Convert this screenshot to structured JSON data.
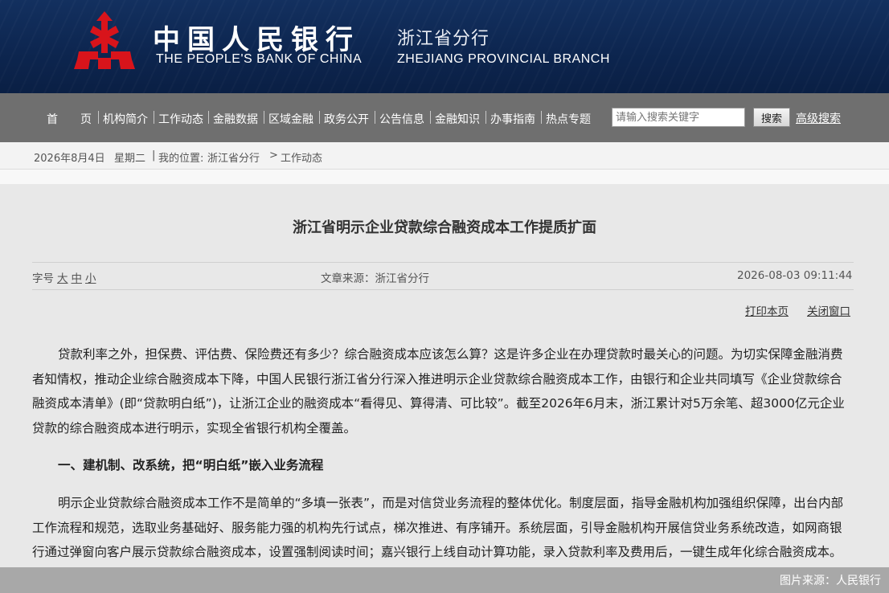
{
  "header": {
    "cn_name": "中国人民银行",
    "cn_branch": "浙江省分行",
    "en_name": "THE PEOPLE'S BANK OF CHINA",
    "en_branch": "ZHEJIANG PROVINCIAL BRANCH",
    "brand_color": "#13305f",
    "logo_color": "#d8141b"
  },
  "nav": {
    "items": [
      "首　　页",
      "机构简介",
      "工作动态",
      "金融数据",
      "区域金融",
      "政务公开",
      "公告信息",
      "金融知识",
      "办事指南",
      "热点专题"
    ],
    "search_placeholder": "请输入搜索关键字",
    "search_button": "搜索",
    "advanced_search": "高级搜索"
  },
  "breadcrumb": {
    "date": "2026年8月4日",
    "weekday": "星期二",
    "separator": "|",
    "location_label": "我的位置:",
    "path": [
      "浙江省分行",
      "工作动态"
    ],
    "arrow": ">"
  },
  "article": {
    "title": "浙江省明示企业贷款综合融资成本工作提质扩面",
    "font_size_label": "字号",
    "font_sizes": [
      "大",
      "中",
      "小"
    ],
    "source": "文章来源：浙江省分行",
    "datetime": "2026-08-03 09:11:44",
    "print_link": "打印本页",
    "close_link": "关闭窗口",
    "paragraphs": [
      "贷款利率之外，担保费、评估费、保险费还有多少？综合融资成本应该怎么算？这是许多企业在办理贷款时最关心的问题。为切实保障金融消费者知情权，推动企业综合融资成本下降，中国人民银行浙江省分行深入推进明示企业贷款综合融资成本工作，由银行和企业共同填写《企业贷款综合融资成本清单》(即“贷款明白纸”)，让浙江企业的融资成本“看得见、算得清、可比较”。截至2026年6月末，浙江累计对5万余笔、超3000亿元企业贷款的综合融资成本进行明示，实现全省银行机构全覆盖。",
      "明示企业贷款综合融资成本工作不是简单的“多填一张表”，而是对信贷业务流程的整体优化。制度层面，指导金融机构加强组织保障，出台内部工作流程和规范，选取业务基础好、服务能力强的机构先行试点，梯次推进、有序铺开。系统层面，引导金融机构开展信贷业务系统改造，如网商银行通过弹窗向客户展示贷款综合融资成本，设置强制阅读时间；嘉兴银行上线自动计算功能，录入贷款利率及费用后，一键生成年化综合融资成本。"
    ],
    "heading_1": "一、建机制、改系统，把“明白纸”嵌入业务流程"
  },
  "caption": "图片来源：人民银行"
}
